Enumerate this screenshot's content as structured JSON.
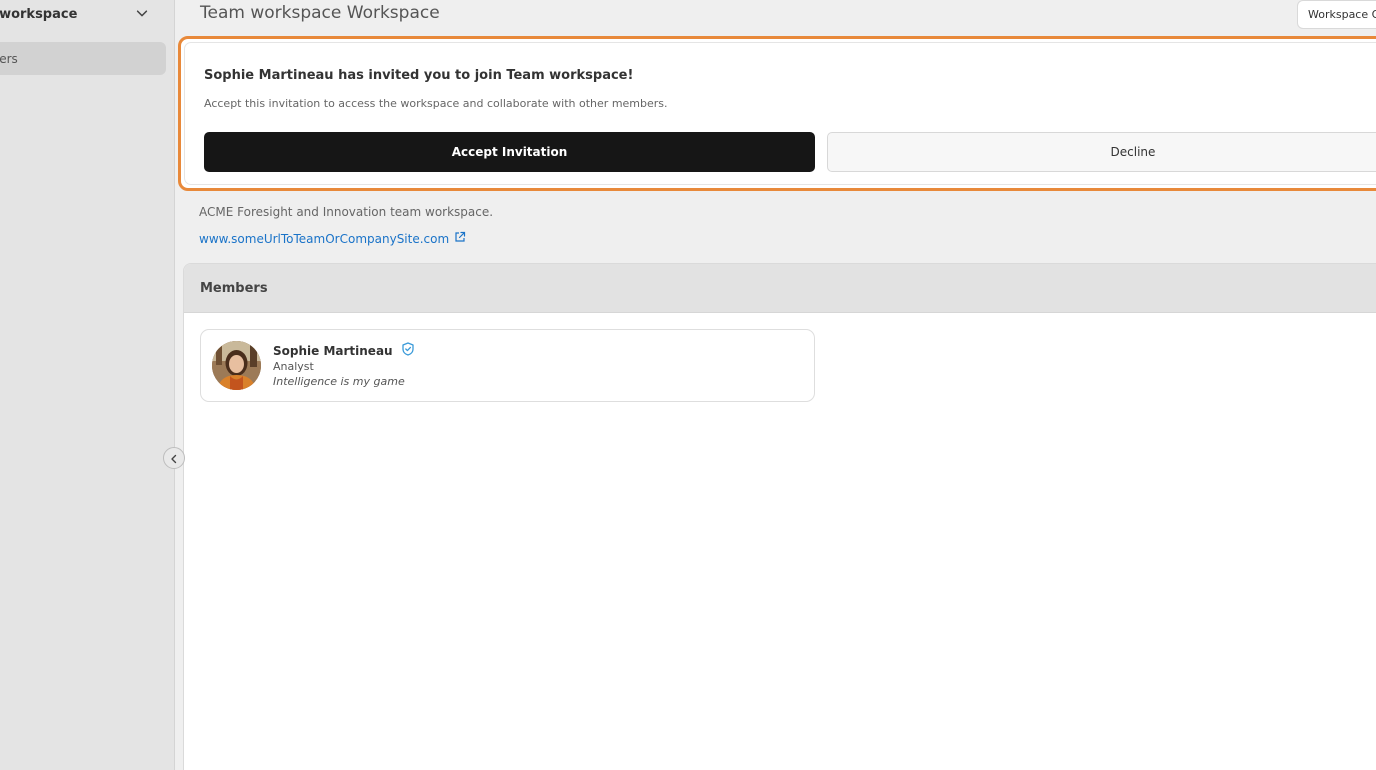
{
  "sidebar": {
    "workspace_name": "m workspace",
    "items": [
      {
        "label": "nbers"
      }
    ]
  },
  "header": {
    "title": "Team workspace Workspace",
    "options_label": "Workspace O"
  },
  "invitation": {
    "title": "Sophie Martineau has invited you to join Team workspace!",
    "description": "Accept this invitation to access the workspace and collaborate with other members.",
    "accept_label": "Accept Invitation",
    "decline_label": "Decline"
  },
  "workspace": {
    "description": "ACME Foresight and Innovation team workspace.",
    "link_text": "www.someUrlToTeamOrCompanySite.com"
  },
  "members": {
    "title": "Members",
    "list": [
      {
        "name": "Sophie Martineau",
        "role": "Analyst",
        "tagline": "Intelligence is my game",
        "badge_icon": "verified-shield-icon"
      }
    ]
  },
  "colors": {
    "accent_orange": "#e8893a",
    "link_blue": "#1a73c8",
    "verified_blue": "#3a9ad9",
    "primary_button": "#161616"
  }
}
